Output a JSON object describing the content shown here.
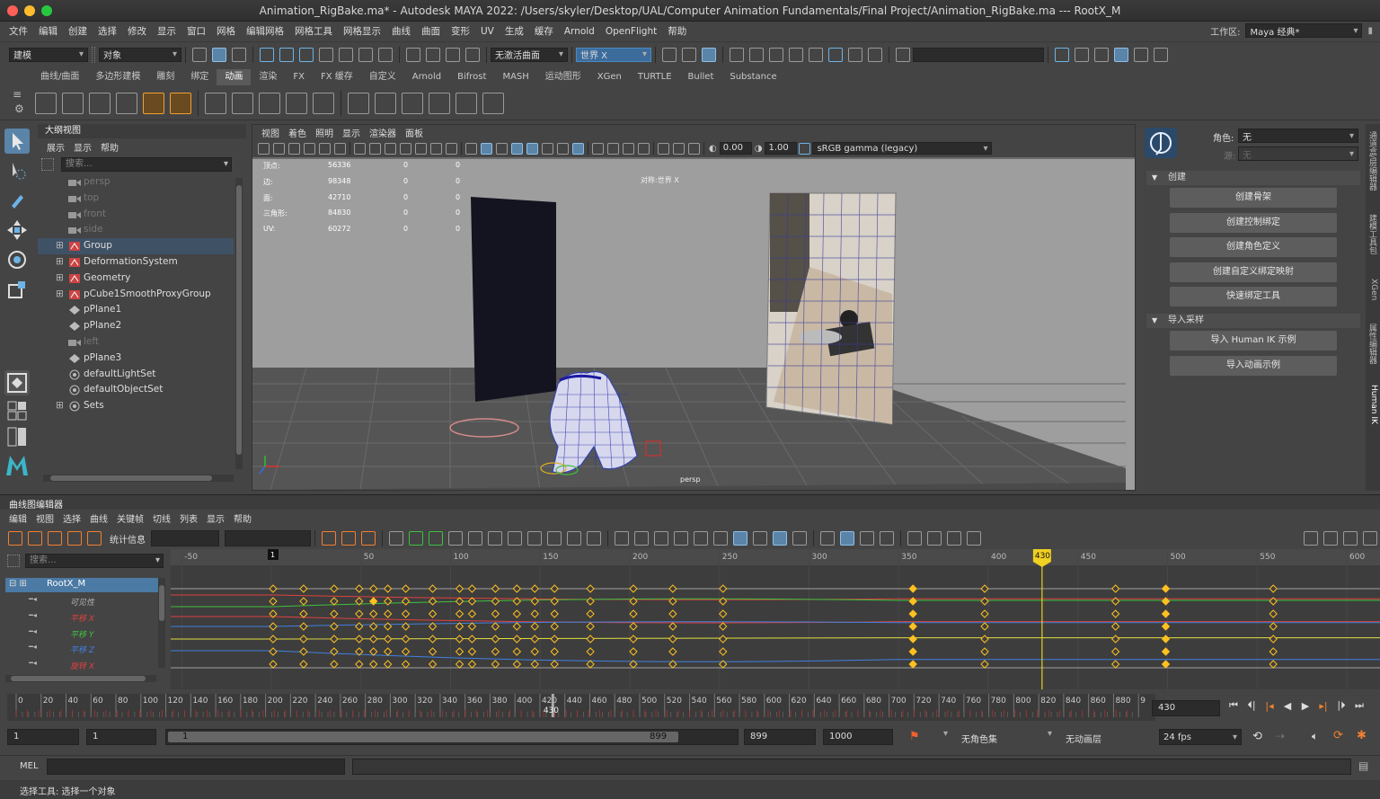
{
  "window": {
    "title": "Animation_RigBake.ma* - Autodesk MAYA 2022: /Users/skyler/Desktop/UAL/Computer Animation Fundamentals/Final Project/Animation_RigBake.ma   ---   RootX_M"
  },
  "menu": [
    "文件",
    "编辑",
    "创建",
    "选择",
    "修改",
    "显示",
    "窗口",
    "网格",
    "编辑网格",
    "网格工具",
    "网格显示",
    "曲线",
    "曲面",
    "变形",
    "UV",
    "生成",
    "缓存",
    "Arnold",
    "OpenFlight",
    "帮助"
  ],
  "workspace": {
    "label": "工作区:",
    "value": "Maya 经典*"
  },
  "status_line": {
    "mode": "建模",
    "object_mode": "对象",
    "live_surface": "无激活曲面",
    "symmetry": "世界 X"
  },
  "shelf_tabs": [
    "曲线/曲面",
    "多边形建模",
    "雕刻",
    "绑定",
    "动画",
    "渲染",
    "FX",
    "FX 缓存",
    "自定义",
    "Arnold",
    "Bifrost",
    "MASH",
    "运动图形",
    "XGen",
    "TURTLE",
    "Bullet",
    "Substance"
  ],
  "shelf_active": "动画",
  "outliner": {
    "title": "大纲视图",
    "menu": [
      "展示",
      "显示",
      "帮助"
    ],
    "search_placeholder": "搜索...",
    "items": [
      {
        "label": "persp",
        "dim": true,
        "kind": "cam"
      },
      {
        "label": "top",
        "dim": true,
        "kind": "cam"
      },
      {
        "label": "front",
        "dim": true,
        "kind": "cam"
      },
      {
        "label": "side",
        "dim": true,
        "kind": "cam"
      },
      {
        "label": "Group",
        "dim": false,
        "kind": "group",
        "expand": true,
        "selected": true
      },
      {
        "label": "DeformationSystem",
        "dim": false,
        "kind": "group",
        "expand": true
      },
      {
        "label": "Geometry",
        "dim": false,
        "kind": "group",
        "expand": true
      },
      {
        "label": "pCube1SmoothProxyGroup",
        "dim": false,
        "kind": "group",
        "expand": true
      },
      {
        "label": "pPlane1",
        "dim": false,
        "kind": "mesh"
      },
      {
        "label": "pPlane2",
        "dim": false,
        "kind": "mesh"
      },
      {
        "label": "left",
        "dim": true,
        "kind": "cam"
      },
      {
        "label": "pPlane3",
        "dim": false,
        "kind": "mesh"
      },
      {
        "label": "defaultLightSet",
        "dim": false,
        "kind": "set"
      },
      {
        "label": "defaultObjectSet",
        "dim": false,
        "kind": "set"
      },
      {
        "label": "Sets",
        "dim": false,
        "kind": "set",
        "expand": true
      }
    ]
  },
  "viewport": {
    "menu": [
      "视图",
      "着色",
      "照明",
      "显示",
      "渲染器",
      "面板"
    ],
    "near": "0.00",
    "far": "1.00",
    "colorspace": "sRGB gamma (legacy)",
    "hud": [
      {
        "label": "顶点:",
        "a": "56336",
        "b": "0",
        "c": "0"
      },
      {
        "label": "边:",
        "a": "98348",
        "b": "0",
        "c": "0"
      },
      {
        "label": "面:",
        "a": "42710",
        "b": "0",
        "c": "0"
      },
      {
        "label": "三角形:",
        "a": "84830",
        "b": "0",
        "c": "0"
      },
      {
        "label": "UV:",
        "a": "60272",
        "b": "0",
        "c": "0"
      }
    ],
    "symmetry_hud": "对称:世界 X",
    "camera": "persp"
  },
  "hik": {
    "char_label": "角色:",
    "char_value": "无",
    "source_label": "源:",
    "source_value": "无",
    "sections": [
      {
        "title": "创建",
        "buttons": [
          "创建骨架",
          "创建控制绑定",
          "创建角色定义",
          "创建自定义绑定映射",
          "快速绑定工具"
        ]
      },
      {
        "title": "导入采样",
        "buttons": [
          "导入 Human IK 示例",
          "导入动画示例"
        ]
      }
    ],
    "side_tabs": [
      "通道盒/层编辑器",
      "建模工具包",
      "XGen",
      "属性编辑器",
      "Human IK"
    ]
  },
  "graph_editor": {
    "title": "曲线图编辑器",
    "menu": [
      "编辑",
      "视图",
      "选择",
      "曲线",
      "关键帧",
      "切线",
      "列表",
      "显示",
      "帮助"
    ],
    "stats_label": "统计信息",
    "search_placeholder": "搜索...",
    "node": "RootX_M",
    "attrs": [
      {
        "label": "可见性",
        "color": "#b0b0b0"
      },
      {
        "label": "平移 X",
        "color": "#e04040"
      },
      {
        "label": "平移 Y",
        "color": "#40c040"
      },
      {
        "label": "平移 Z",
        "color": "#4080e0"
      },
      {
        "label": "旋转 X",
        "color": "#e04040"
      }
    ],
    "ruler": [
      "-50",
      "0",
      "50",
      "100",
      "150",
      "200",
      "250",
      "300",
      "350",
      "400",
      "450",
      "500",
      "550",
      "600"
    ],
    "start_marker": "1",
    "current_frame": "430"
  },
  "time_slider": {
    "ticks": [
      "0",
      "20",
      "40",
      "60",
      "80",
      "100",
      "120",
      "140",
      "160",
      "180",
      "200",
      "220",
      "240",
      "260",
      "280",
      "300",
      "320",
      "340",
      "360",
      "380",
      "400",
      "420",
      "440",
      "460",
      "480",
      "500",
      "520",
      "540",
      "560",
      "580",
      "600",
      "620",
      "640",
      "660",
      "680",
      "700",
      "720",
      "740",
      "760",
      "780",
      "800",
      "820",
      "840",
      "860",
      "880",
      "9"
    ],
    "current": "430",
    "current_field": "430"
  },
  "range": {
    "start": "1",
    "play_start": "1",
    "bar_start": "1",
    "bar_end": "899",
    "play_end": "899",
    "end": "1000",
    "char_set": "无角色集",
    "anim_layer": "无动画层",
    "fps": "24 fps"
  },
  "cmd": {
    "lang": "MEL"
  },
  "help": {
    "text": "选择工具: 选择一个对象"
  }
}
